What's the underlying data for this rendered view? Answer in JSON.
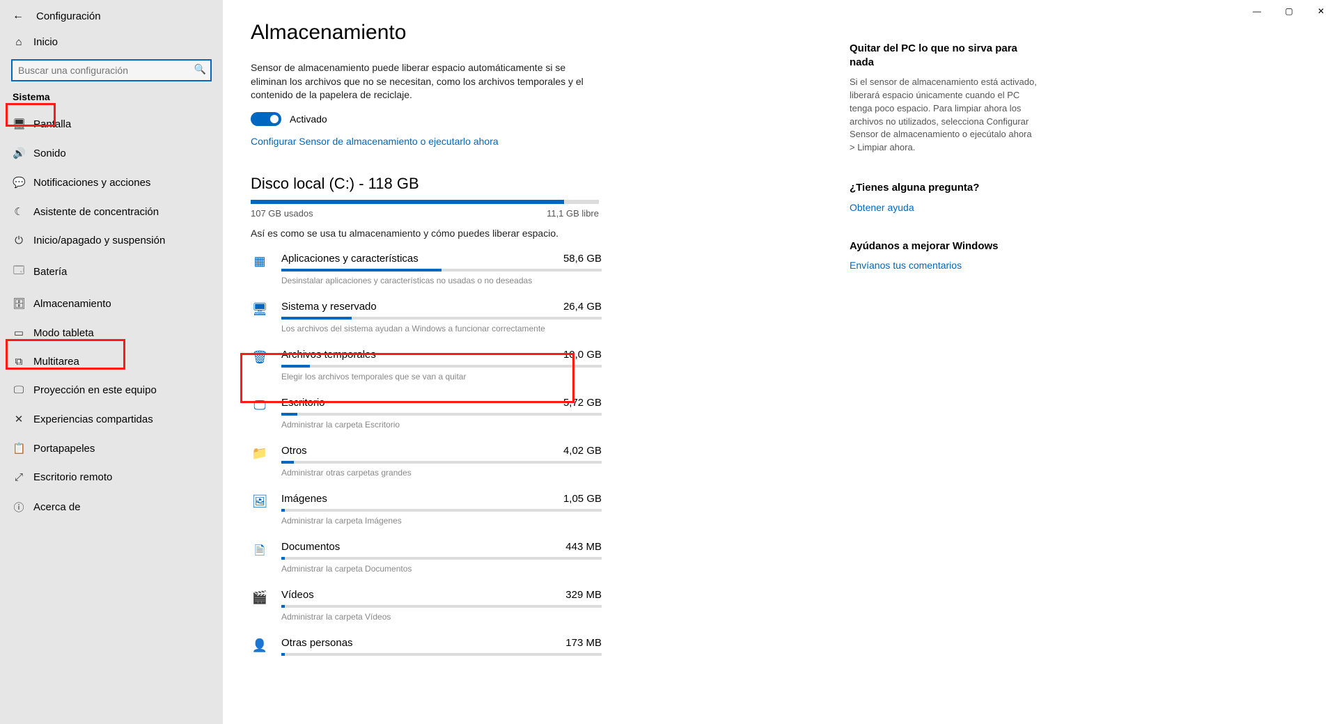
{
  "window": {
    "title": "Configuración",
    "min": "—",
    "max": "▢",
    "close": "✕"
  },
  "sidebar": {
    "home": "Inicio",
    "search_placeholder": "Buscar una configuración",
    "section": "Sistema",
    "items": [
      {
        "icon": "🖥",
        "label": "Pantalla"
      },
      {
        "icon": "🔊",
        "label": "Sonido"
      },
      {
        "icon": "💬",
        "label": "Notificaciones y acciones"
      },
      {
        "icon": "☾",
        "label": "Asistente de concentración"
      },
      {
        "icon": "⏻",
        "label": "Inicio/apagado y suspensión"
      },
      {
        "icon": "🗔",
        "label": "Batería"
      },
      {
        "icon": "🗄",
        "label": "Almacenamiento"
      },
      {
        "icon": "▭",
        "label": "Modo tableta"
      },
      {
        "icon": "⧉",
        "label": "Multitarea"
      },
      {
        "icon": "🖵",
        "label": "Proyección en este equipo"
      },
      {
        "icon": "✕",
        "label": "Experiencias compartidas"
      },
      {
        "icon": "📋",
        "label": "Portapapeles"
      },
      {
        "icon": "⤢",
        "label": "Escritorio remoto"
      },
      {
        "icon": "ⓘ",
        "label": "Acerca de"
      }
    ]
  },
  "page": {
    "title": "Almacenamiento",
    "sense_desc": "Sensor de almacenamiento puede liberar espacio automáticamente si se eliminan los archivos que no se necesitan, como los archivos temporales y el contenido de la papelera de reciclaje.",
    "toggle_label": "Activado",
    "config_link": "Configurar Sensor de almacenamiento o ejecutarlo ahora",
    "drive_title": "Disco local (C:) - 118 GB",
    "used": "107 GB usados",
    "free": "11,1 GB libre",
    "used_pct": 90,
    "breakdown_desc": "Así es como se usa tu almacenamiento y cómo puedes liberar espacio.",
    "categories": [
      {
        "icon": "▦",
        "name": "Aplicaciones y características",
        "size": "58,6 GB",
        "hint": "Desinstalar aplicaciones y características no usadas o no deseadas",
        "pct": 50
      },
      {
        "icon": "🖥",
        "name": "Sistema y reservado",
        "size": "26,4 GB",
        "hint": "Los archivos del sistema ayudan a Windows a funcionar correctamente",
        "pct": 22
      },
      {
        "icon": "🗑",
        "name": "Archivos temporales",
        "size": "10,0 GB",
        "hint": "Elegir los archivos temporales que se van a quitar",
        "pct": 9
      },
      {
        "icon": "🖵",
        "name": "Escritorio",
        "size": "5,72 GB",
        "hint": "Administrar la carpeta Escritorio",
        "pct": 5
      },
      {
        "icon": "📁",
        "name": "Otros",
        "size": "4,02 GB",
        "hint": "Administrar otras carpetas grandes",
        "pct": 4
      },
      {
        "icon": "🖼",
        "name": "Imágenes",
        "size": "1,05 GB",
        "hint": "Administrar la carpeta Imágenes",
        "pct": 1
      },
      {
        "icon": "🗎",
        "name": "Documentos",
        "size": "443 MB",
        "hint": "Administrar la carpeta Documentos",
        "pct": 1
      },
      {
        "icon": "🎬",
        "name": "Vídeos",
        "size": "329 MB",
        "hint": "Administrar la carpeta Vídeos",
        "pct": 1
      },
      {
        "icon": "👤",
        "name": "Otras personas",
        "size": "173 MB",
        "hint": "",
        "pct": 1
      }
    ]
  },
  "aside": {
    "blocks": [
      {
        "title": "Quitar del PC lo que no sirva para nada",
        "text": "Si el sensor de almacenamiento está activado, liberará espacio únicamente cuando el PC tenga poco espacio. Para limpiar ahora los archivos no utilizados, selecciona Configurar Sensor de almacenamiento o ejecútalo ahora > Limpiar ahora."
      },
      {
        "title": "¿Tienes alguna pregunta?",
        "link": "Obtener ayuda"
      },
      {
        "title": "Ayúdanos a mejorar Windows",
        "link": "Envíanos tus comentarios"
      }
    ]
  }
}
